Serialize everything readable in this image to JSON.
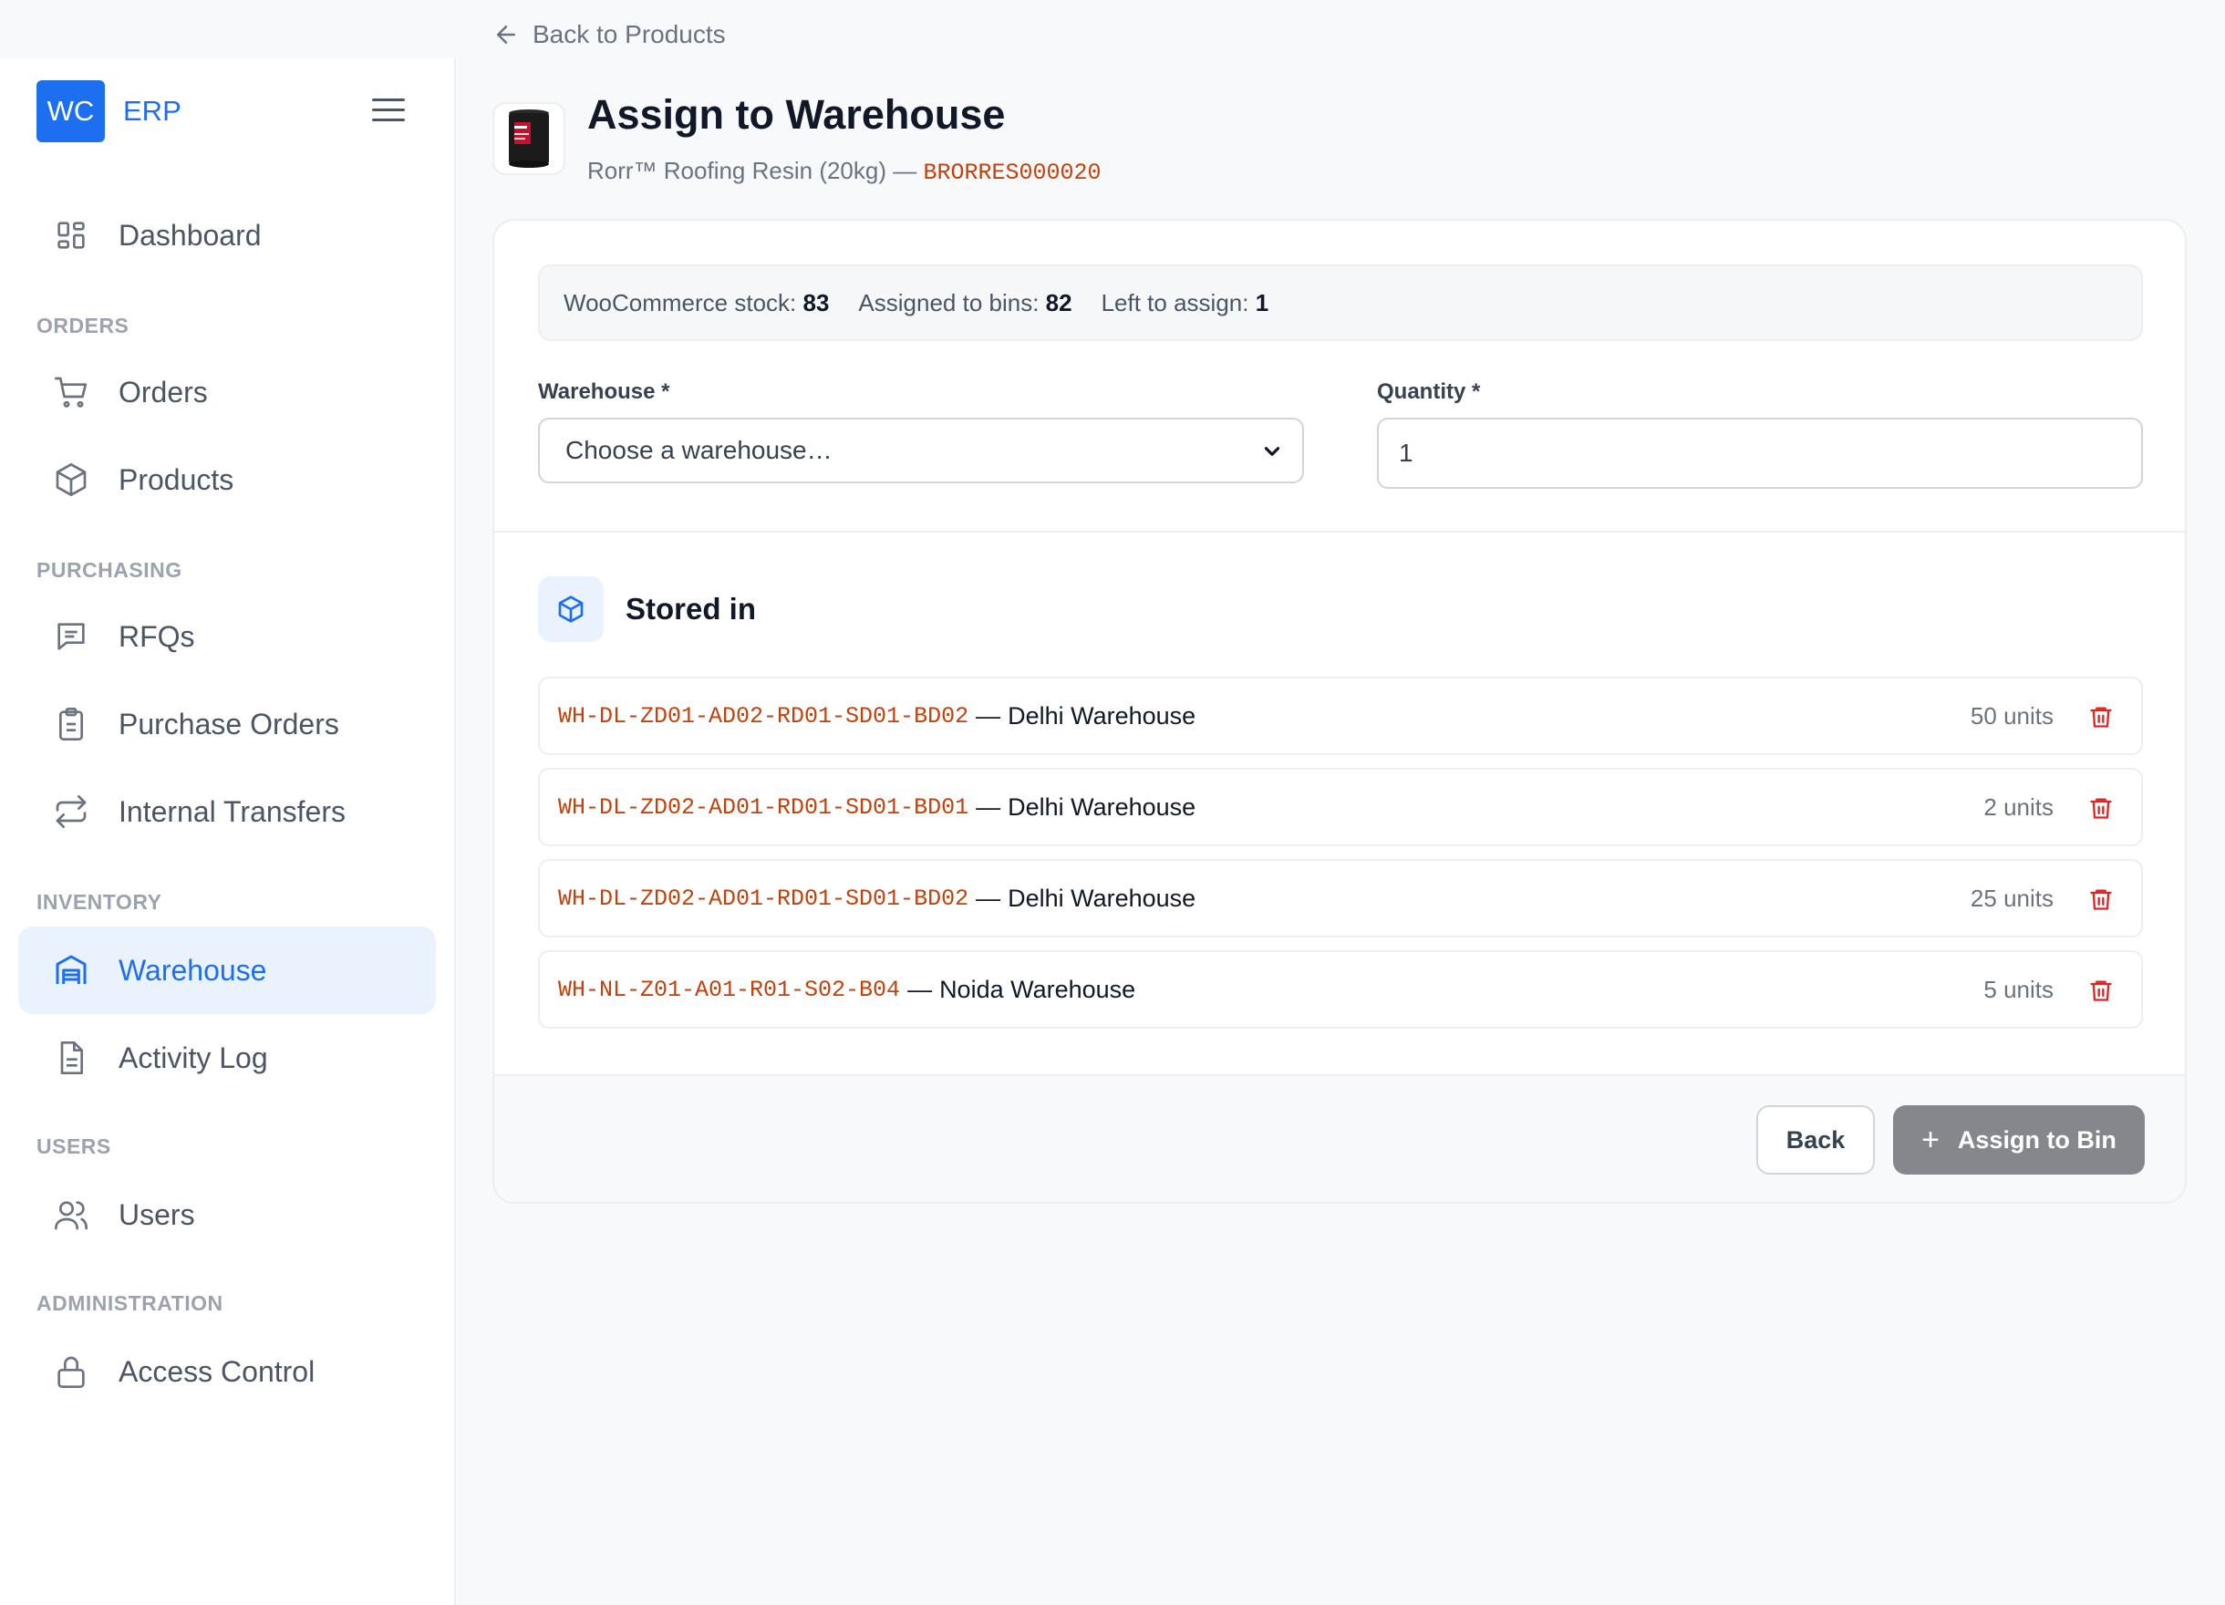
{
  "brand": {
    "logo": "WC",
    "name": "ERP",
    "menu_icon": "hamburger-icon"
  },
  "sidebar": {
    "items": [
      {
        "label": "Dashboard",
        "icon": "dashboard-icon"
      },
      {
        "label": "Orders",
        "icon": "cart-icon"
      },
      {
        "label": "Products",
        "icon": "box-icon"
      },
      {
        "label": "RFQs",
        "icon": "message-icon"
      },
      {
        "label": "Purchase Orders",
        "icon": "clipboard-icon"
      },
      {
        "label": "Internal Transfers",
        "icon": "transfer-icon"
      },
      {
        "label": "Warehouse",
        "icon": "warehouse-icon",
        "active": true
      },
      {
        "label": "Activity Log",
        "icon": "document-icon"
      },
      {
        "label": "Users",
        "icon": "users-icon"
      },
      {
        "label": "Access Control",
        "icon": "lock-icon"
      }
    ],
    "sections": [
      "ORDERS",
      "PURCHASING",
      "INVENTORY",
      "USERS",
      "ADMINISTRATION"
    ]
  },
  "header": {
    "back_label": "Back to Products",
    "title": "Assign to Warehouse",
    "product_name": "Rorr™ Roofing Resin (20kg) —",
    "sku": "BRORRES000020"
  },
  "stock": {
    "woo_label": "WooCommerce stock:",
    "woo_value": "83",
    "assigned_label": "Assigned to bins:",
    "assigned_value": "82",
    "left_label": "Left to assign:",
    "left_value": "1"
  },
  "form": {
    "warehouse_label": "Warehouse *",
    "warehouse_value": "Choose a warehouse…",
    "quantity_label": "Quantity *",
    "quantity_value": "1"
  },
  "stored": {
    "title": "Stored in",
    "rows": [
      {
        "code": "WH-DL-ZD01-AD02-RD01-SD01-BD02",
        "sep": "—",
        "warehouse": "Delhi Warehouse",
        "units": "50 units"
      },
      {
        "code": "WH-DL-ZD02-AD01-RD01-SD01-BD01",
        "sep": "—",
        "warehouse": "Delhi Warehouse",
        "units": "2 units"
      },
      {
        "code": "WH-DL-ZD02-AD01-RD01-SD01-BD02",
        "sep": "—",
        "warehouse": "Delhi Warehouse",
        "units": "25 units"
      },
      {
        "code": "WH-NL-Z01-A01-R01-S02-B04",
        "sep": "—",
        "warehouse": "Noida Warehouse",
        "units": "5 units"
      }
    ]
  },
  "footer": {
    "back_label": "Back",
    "assign_label": "Assign to Bin"
  },
  "colors": {
    "accent": "#1e6ff0",
    "sku": "#c2410c",
    "danger": "#dc2626",
    "disabled_button": "#85878c"
  }
}
